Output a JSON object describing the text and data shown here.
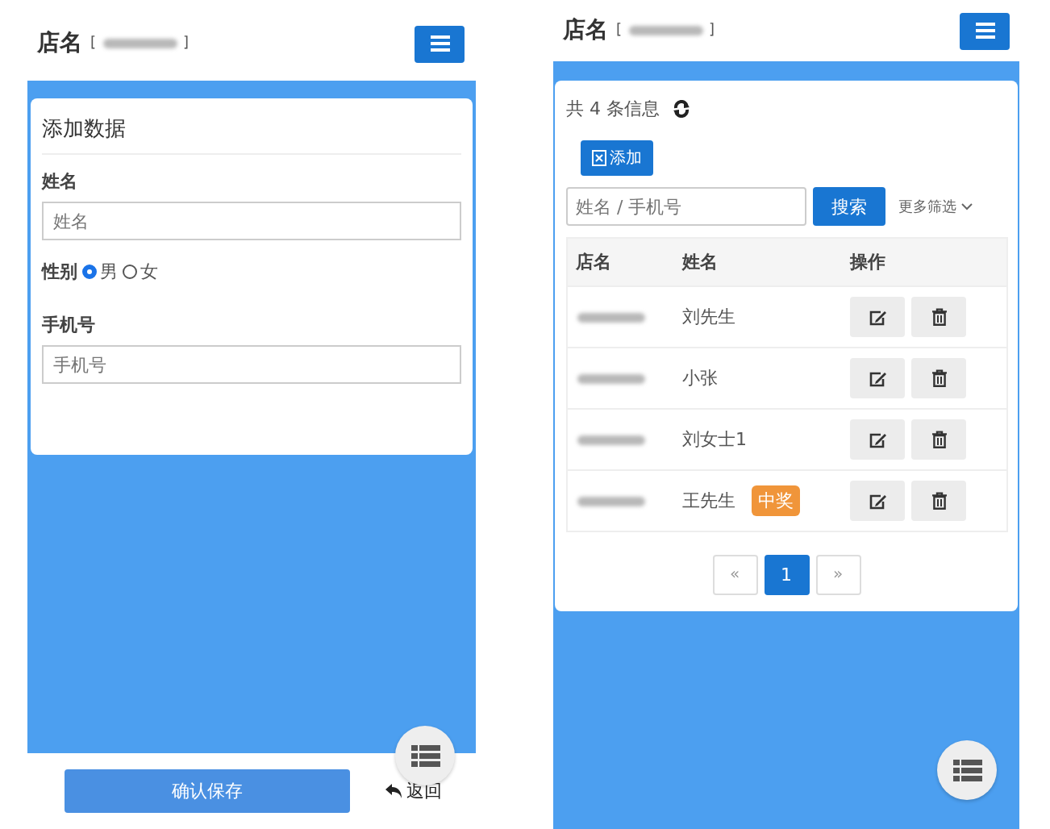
{
  "screens": [
    {
      "kind": "form",
      "header": {
        "title": "店名",
        "bracket_open": "[",
        "bracket_close": "]"
      },
      "card": {
        "title": "添加数据",
        "fields": [
          {
            "kind": "text",
            "label": "姓名",
            "placeholder": "姓名"
          },
          {
            "kind": "radio",
            "label": "性别",
            "options": [
              {
                "label": "男",
                "selected": true
              },
              {
                "label": "女",
                "selected": false
              }
            ]
          },
          {
            "kind": "text",
            "label": "手机号",
            "placeholder": "手机号"
          }
        ]
      },
      "footer": {
        "save": "确认保存",
        "back": "返回"
      }
    },
    {
      "kind": "list",
      "header": {
        "title": "店名",
        "bracket_open": "[",
        "bracket_close": "]"
      },
      "summary": "共 4 条信息",
      "add_button": "添加",
      "search": {
        "placeholder": "姓名 / 手机号",
        "button": "搜索",
        "filter": "更多筛选"
      },
      "table": {
        "columns": [
          "店名",
          "姓名",
          "操作"
        ],
        "rows": [
          {
            "name": "刘先生"
          },
          {
            "name": "小张"
          },
          {
            "name": "刘女士1"
          },
          {
            "name": "王先生",
            "badge": "中奖"
          }
        ]
      },
      "pagination": [
        {
          "label": "«",
          "selected": false
        },
        {
          "label": "1",
          "selected": true
        },
        {
          "label": "»",
          "selected": false
        }
      ]
    }
  ]
}
